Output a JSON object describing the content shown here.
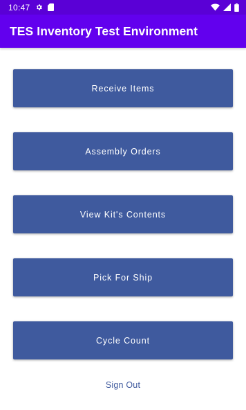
{
  "status_bar": {
    "time": "10:47",
    "left_icons": [
      "gear-icon",
      "sd-card-icon"
    ],
    "right_icons": [
      "wifi-icon",
      "cellular-signal-icon",
      "battery-icon"
    ]
  },
  "app_bar": {
    "title": "TES Inventory Test Environment",
    "color": "#6200ee"
  },
  "menu": {
    "buttons": [
      {
        "label": "Receive Items"
      },
      {
        "label": "Assembly Orders"
      },
      {
        "label": "View Kit's Contents"
      },
      {
        "label": "Pick For Ship"
      },
      {
        "label": "Cycle Count"
      }
    ],
    "button_color": "#3f5a9e"
  },
  "sign_out": {
    "label": "Sign Out"
  }
}
